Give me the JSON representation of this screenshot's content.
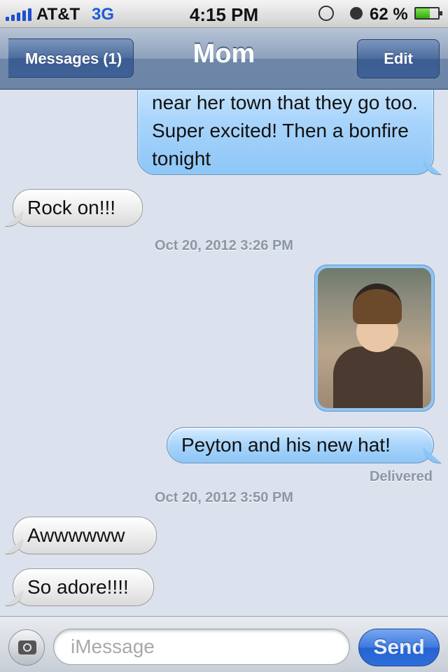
{
  "status_bar": {
    "carrier": "AT&T",
    "network": "3G",
    "time": "4:15 PM",
    "battery_percent": "62 %",
    "battery_level": 0.62
  },
  "nav": {
    "back_label": "Messages (1)",
    "title": "Mom",
    "edit_label": "Edit"
  },
  "messages": [
    {
      "direction": "outgoing",
      "text": "near her town that they go too. Super excited! Then a bonfire tonight"
    },
    {
      "direction": "incoming",
      "text": "Rock on!!!"
    },
    {
      "type": "timestamp",
      "text": "Oct 20, 2012 3:26 PM"
    },
    {
      "direction": "outgoing",
      "type": "photo"
    },
    {
      "direction": "outgoing",
      "text": "Peyton and his new hat!"
    },
    {
      "type": "status",
      "text": "Delivered"
    },
    {
      "type": "timestamp",
      "text": "Oct 20, 2012 3:50 PM"
    },
    {
      "direction": "incoming",
      "text": "Awwwwww"
    },
    {
      "direction": "incoming",
      "text": "So adore!!!!"
    }
  ],
  "input_bar": {
    "camera_icon": "camera-icon",
    "placeholder": "iMessage",
    "send_label": "Send"
  }
}
